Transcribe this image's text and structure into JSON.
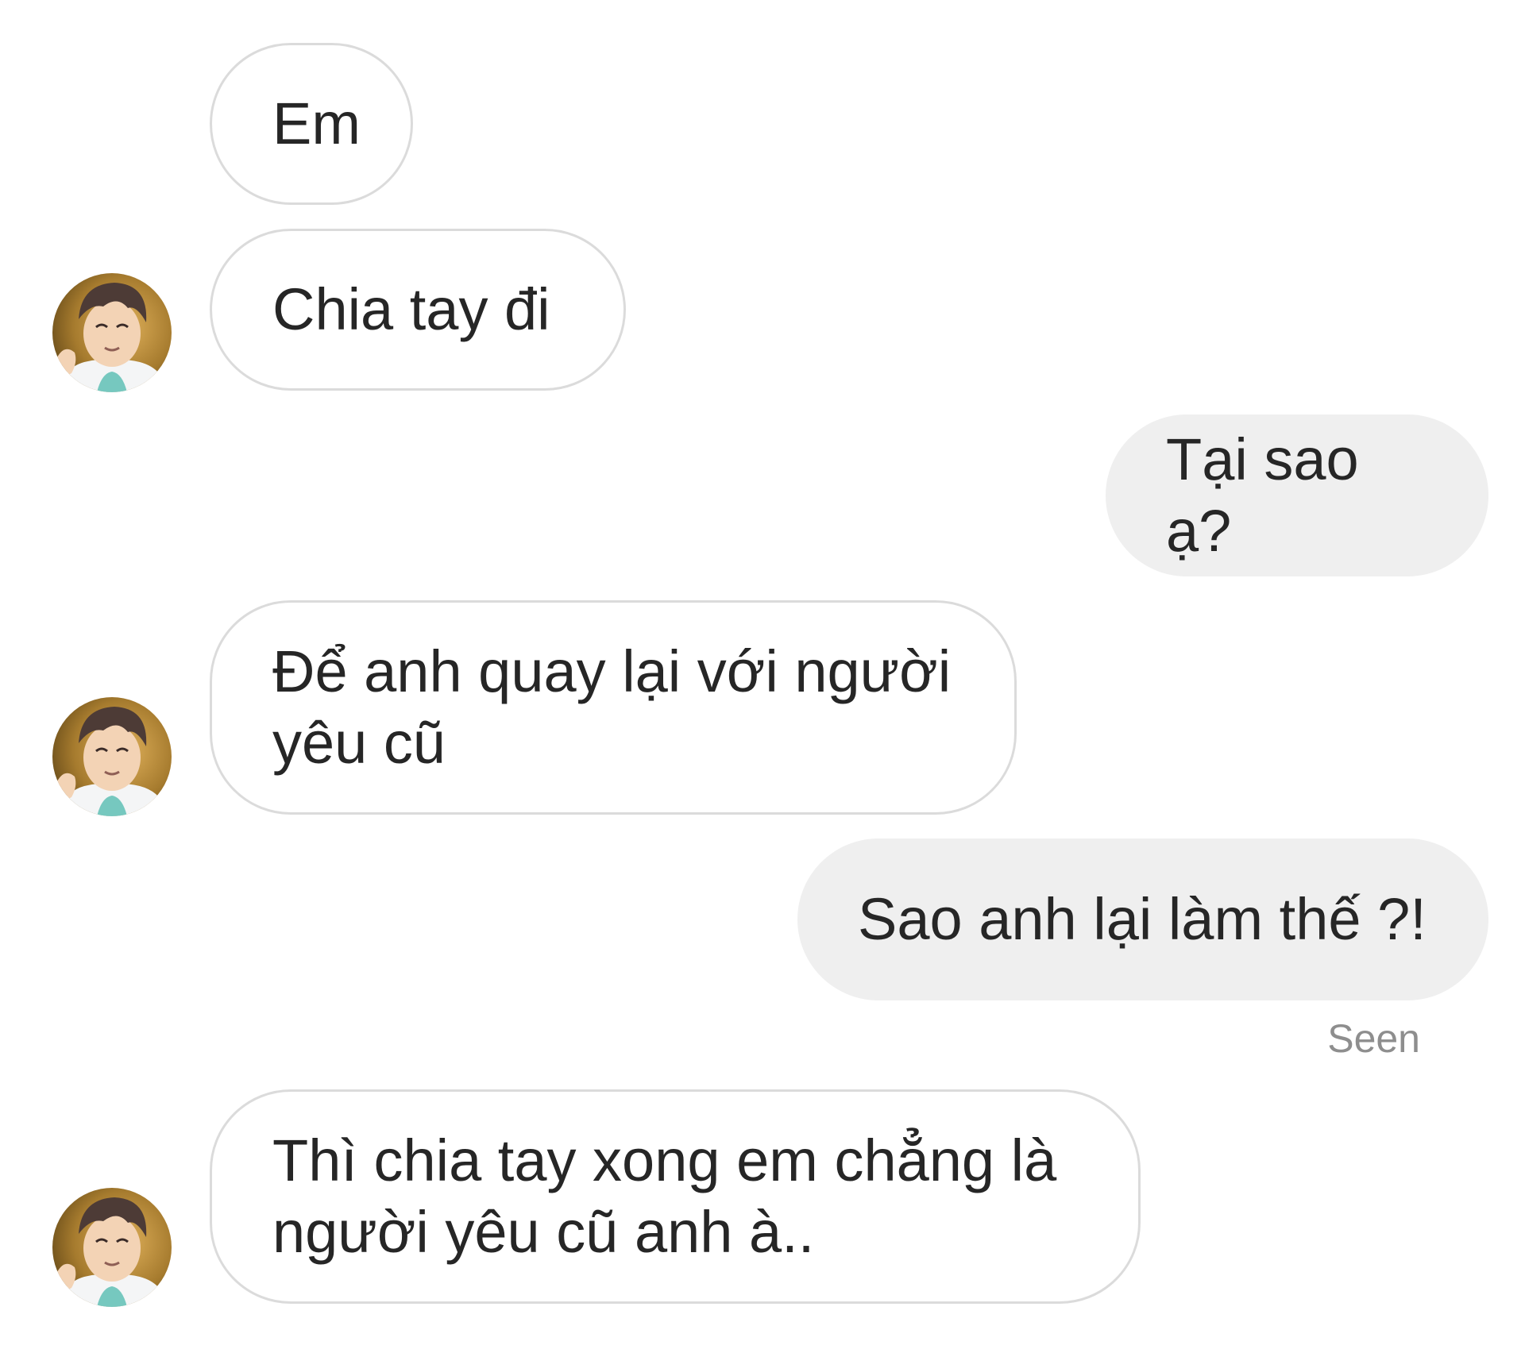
{
  "conversation": {
    "messages": [
      {
        "sender": "other",
        "text": "Em"
      },
      {
        "sender": "other",
        "text": "Chia tay đi"
      },
      {
        "sender": "me",
        "text": "Tại sao ạ?"
      },
      {
        "sender": "other",
        "text": "Để anh quay lại với người\nyêu cũ"
      },
      {
        "sender": "me",
        "text": "Sao anh lại làm thế ?!"
      },
      {
        "sender": "other",
        "text": "Thì chia tay xong em chẳng là\nngười yêu cũ anh à.."
      }
    ],
    "seen_label": "Seen"
  },
  "colors": {
    "incoming_border": "#dbdbdb",
    "outgoing_fill": "#efefef",
    "text": "#262626",
    "seen_text": "#8e8e8e"
  },
  "icons": {
    "avatar": "user-avatar"
  }
}
